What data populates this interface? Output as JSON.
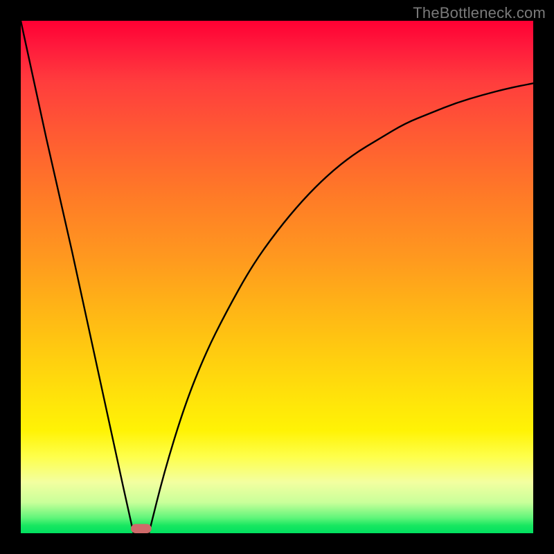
{
  "attribution": "TheBottleneck.com",
  "colors": {
    "frame": "#000000",
    "gradient_top": "#ff0033",
    "gradient_bottom": "#00e060",
    "curve": "#000000",
    "marker": "#cf6a6a"
  },
  "chart_data": {
    "type": "line",
    "title": "",
    "xlabel": "",
    "ylabel": "",
    "xlim": [
      0,
      100
    ],
    "ylim": [
      0,
      100
    ],
    "grid": false,
    "annotations": [],
    "legend": [],
    "series": [
      {
        "name": "left-segment",
        "x": [
          0,
          5,
          10,
          15,
          20,
          22
        ],
        "values": [
          100,
          77,
          55,
          32,
          9,
          0
        ]
      },
      {
        "name": "right-segment",
        "x": [
          25,
          28,
          32,
          36,
          40,
          45,
          50,
          55,
          60,
          65,
          70,
          75,
          80,
          85,
          90,
          95,
          100
        ],
        "values": [
          0,
          12,
          25,
          35,
          43,
          52,
          59,
          65,
          70,
          74,
          77,
          80,
          82,
          84,
          85.5,
          86.8,
          87.8
        ]
      }
    ],
    "marker": {
      "x": 23.5,
      "y": 0,
      "w": 4,
      "h": 1.8
    }
  }
}
